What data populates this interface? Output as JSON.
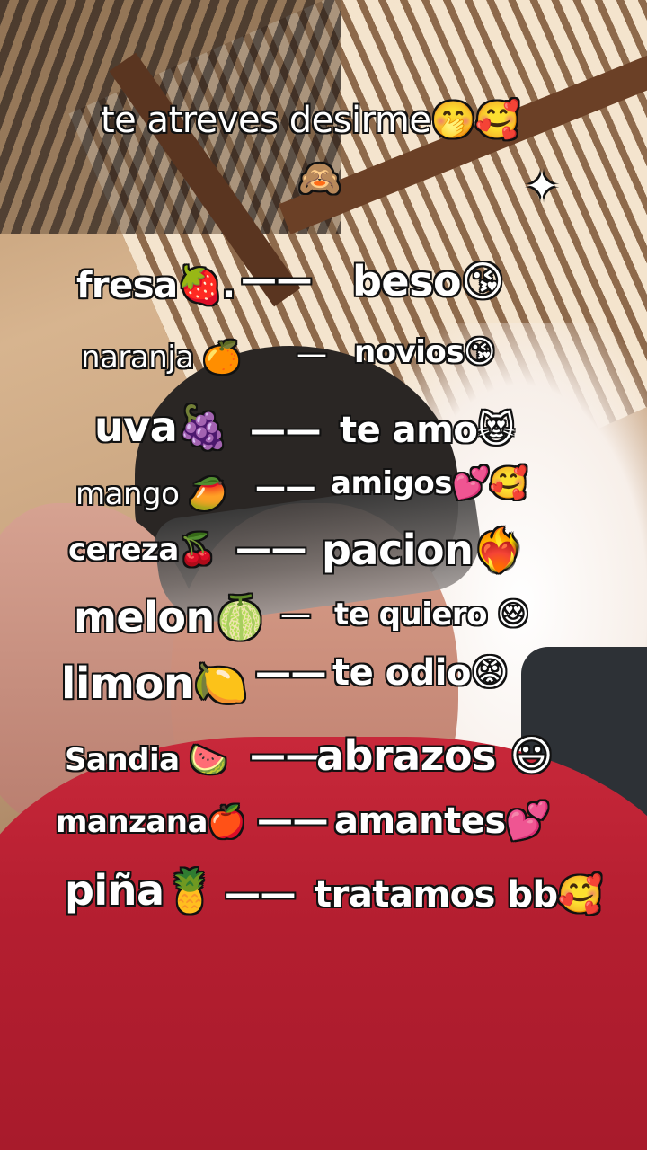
{
  "header": {
    "title": "te atreves desirme🤭🥰",
    "emoji_row": "🙈",
    "sparkle": "✦"
  },
  "rows": [
    {
      "left": "fresa🍓.",
      "dash": "——",
      "right": "beso😘"
    },
    {
      "left": "naranja 🍊",
      "dash": "—",
      "right": "novios😘"
    },
    {
      "left": "uva🍇",
      "dash": "——",
      "right": "te amo😻"
    },
    {
      "left": "mango 🥭",
      "dash": "——",
      "right": "amigos💕🥰"
    },
    {
      "left": "cereza🍒",
      "dash": "——",
      "right": "pacion❤️‍🔥"
    },
    {
      "left": "melon🍈",
      "dash": "—",
      "right": "te quiero 😍"
    },
    {
      "left": "limon🍋",
      "dash": "——",
      "right": "te odio😡"
    },
    {
      "left": "Sandia 🍉",
      "dash": "——",
      "right": "abrazos 😃"
    },
    {
      "left": "manzana🍎",
      "dash": "——",
      "right": "amantes💕"
    },
    {
      "left": "piña🍍",
      "dash": "——",
      "right": "tratamos bb🥰"
    }
  ]
}
